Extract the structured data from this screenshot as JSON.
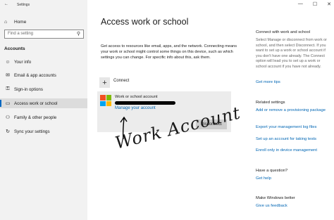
{
  "window": {
    "title": "Settings",
    "controls": [
      "—",
      "☐",
      "✕"
    ]
  },
  "sidebar": {
    "home_label": "Home",
    "search_placeholder": "Find a setting",
    "section_title": "Accounts",
    "items": [
      {
        "label": "Your info",
        "icon": "person-icon"
      },
      {
        "label": "Email & app accounts",
        "icon": "mail-icon"
      },
      {
        "label": "Sign-in options",
        "icon": "key-icon"
      },
      {
        "label": "Access work or school",
        "icon": "briefcase-icon"
      },
      {
        "label": "Family & other people",
        "icon": "people-icon"
      },
      {
        "label": "Sync your settings",
        "icon": "sync-icon"
      }
    ]
  },
  "main": {
    "title": "Access work or school",
    "intro": "Get access to resources like email, apps, and the network. Connecting means your work or school might control some things on this device, such as which settings you can change. For specific info about this, ask them.",
    "connect_label": "Connect",
    "account": {
      "name": "Work or school account",
      "manage_link": "Manage your account",
      "disconnect_label": "Disconnect"
    },
    "annotation": "Work Account"
  },
  "right_panel": {
    "connect_heading": "Connect with work and school",
    "connect_text": "Select Manage or disconnect from work or school, and then select Disconnect. If you want to set up a work or school account if you don't have one already. The Connect option will lead you to set up a work or school account if you have not already.",
    "more_tips": "Get more tips",
    "related_heading": "Related settings",
    "related_links": [
      "Add or remove a provisioning package",
      "Export your management log files",
      "Set up an account for taking tests",
      "Enroll only in device management"
    ],
    "question_heading": "Have a question?",
    "get_help": "Get help",
    "better_heading": "Make Windows better",
    "feedback": "Give us feedback"
  },
  "colors": {
    "accent": "#0067c0",
    "link": "#0066b4",
    "ms_red": "#f25022",
    "ms_green": "#7fba00",
    "ms_blue": "#00a4ef",
    "ms_yellow": "#ffb900"
  }
}
